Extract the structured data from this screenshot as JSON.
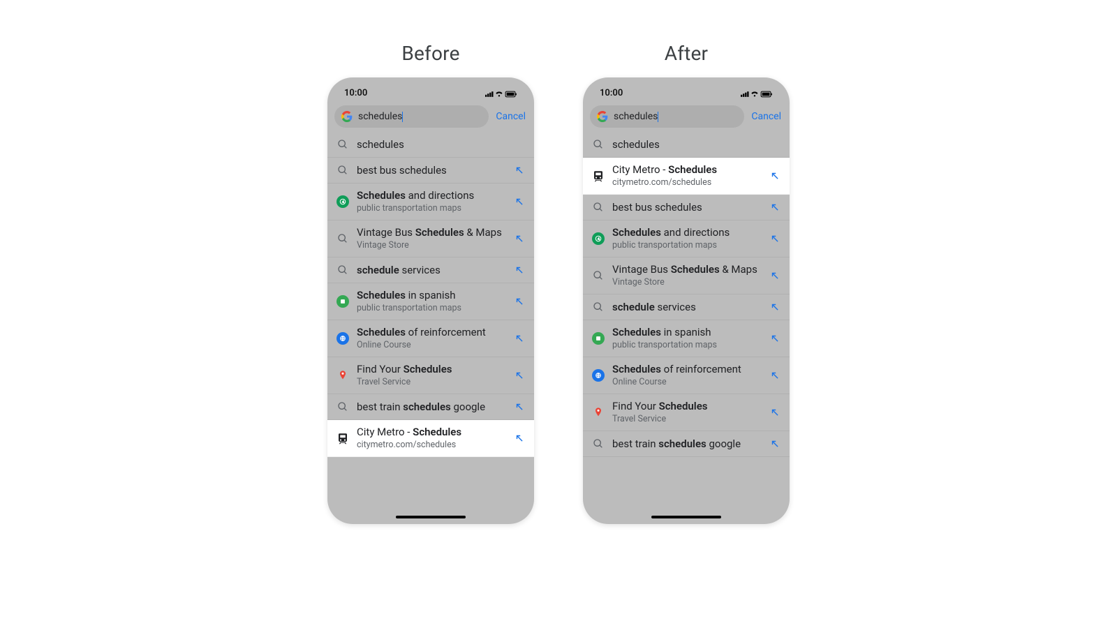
{
  "labels": {
    "before": "Before",
    "after": "After"
  },
  "status": {
    "time": "10:00"
  },
  "search": {
    "query": "schedules",
    "cancel": "Cancel"
  },
  "suggestions_common": {
    "plain_schedules": {
      "title_parts": [
        "schedules"
      ]
    },
    "best_bus": {
      "title_parts": [
        "best bus schedules"
      ]
    },
    "directions": {
      "title_bold": "Schedules",
      "title_rest": " and directions",
      "sub": "public transportation maps"
    },
    "vintage": {
      "t1": "Vintage Bus ",
      "t2": "Schedules",
      "t3": " & Maps",
      "sub": "Vintage Store"
    },
    "schedule_services": {
      "t1": "schedule",
      "t2": " services"
    },
    "spanish": {
      "t1": "Schedules",
      "t2": " in spanish",
      "sub": "public transportation maps"
    },
    "reinforcement": {
      "t1": "Schedules",
      "t2": " of reinforcement",
      "sub": "Online Course"
    },
    "findyour": {
      "t1": "Find Your ",
      "t2": "Schedules",
      "sub": "Travel Service"
    },
    "best_train": {
      "t1": "best train ",
      "t2": "schedules",
      "t3": " google"
    },
    "citymetro": {
      "t1": "City Metro -  ",
      "t2": "Schedules",
      "sub": "citymetro.com/schedules"
    }
  }
}
